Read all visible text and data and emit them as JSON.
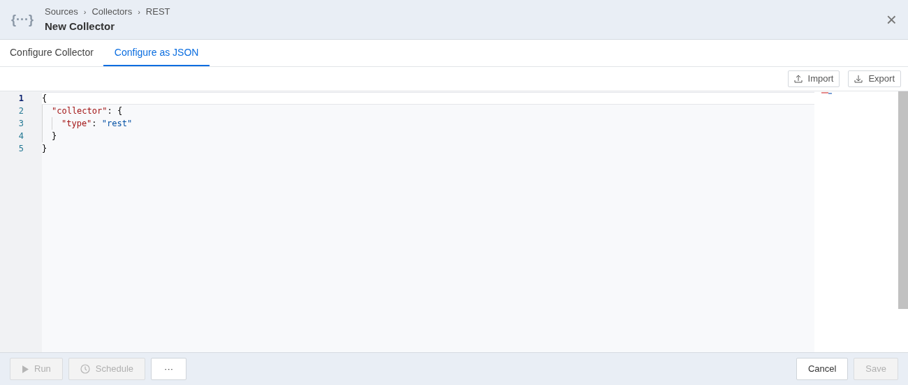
{
  "header": {
    "breadcrumb": [
      "Sources",
      "Collectors",
      "REST"
    ],
    "separator": "›",
    "title": "New Collector",
    "logo": "{···}",
    "close": "×"
  },
  "tabs": [
    {
      "label": "Configure Collector",
      "selected": false
    },
    {
      "label": "Configure as JSON",
      "selected": true
    }
  ],
  "toolbar": [
    {
      "label": "Import",
      "kind": "import"
    },
    {
      "label": "Export",
      "kind": "export"
    }
  ],
  "editor": {
    "lines": [
      {
        "number": "1",
        "active": true,
        "tokens": [
          {
            "kind": "punct",
            "text": "{"
          }
        ],
        "children": [
          {
            "number": "2",
            "active": false,
            "tokens": [
              {
                "kind": "key",
                "text": "\"collector\""
              },
              {
                "kind": "punct",
                "text": ": {"
              }
            ],
            "children": [
              {
                "number": "3",
                "active": false,
                "tokens": [
                  {
                    "kind": "key",
                    "text": "\"type\""
                  },
                  {
                    "kind": "punct",
                    "text": ": "
                  },
                  {
                    "kind": "string",
                    "text": "\"rest\""
                  }
                ]
              }
            ]
          },
          {
            "number": "4",
            "active": false,
            "tokens": [
              {
                "kind": "punct",
                "text": "}"
              }
            ]
          }
        ]
      },
      {
        "number": "5",
        "active": false,
        "tokens": [
          {
            "kind": "punct",
            "text": "}"
          }
        ]
      }
    ]
  },
  "footer": {
    "left": [
      {
        "label": "Run",
        "kind": "run",
        "disabled": true
      },
      {
        "label": "Schedule",
        "kind": "schedule",
        "disabled": true
      },
      {
        "label": "···",
        "kind": "more",
        "disabled": false
      }
    ],
    "right": [
      {
        "label": "Cancel",
        "disabled": false
      },
      {
        "label": "Save",
        "disabled": true
      }
    ]
  }
}
